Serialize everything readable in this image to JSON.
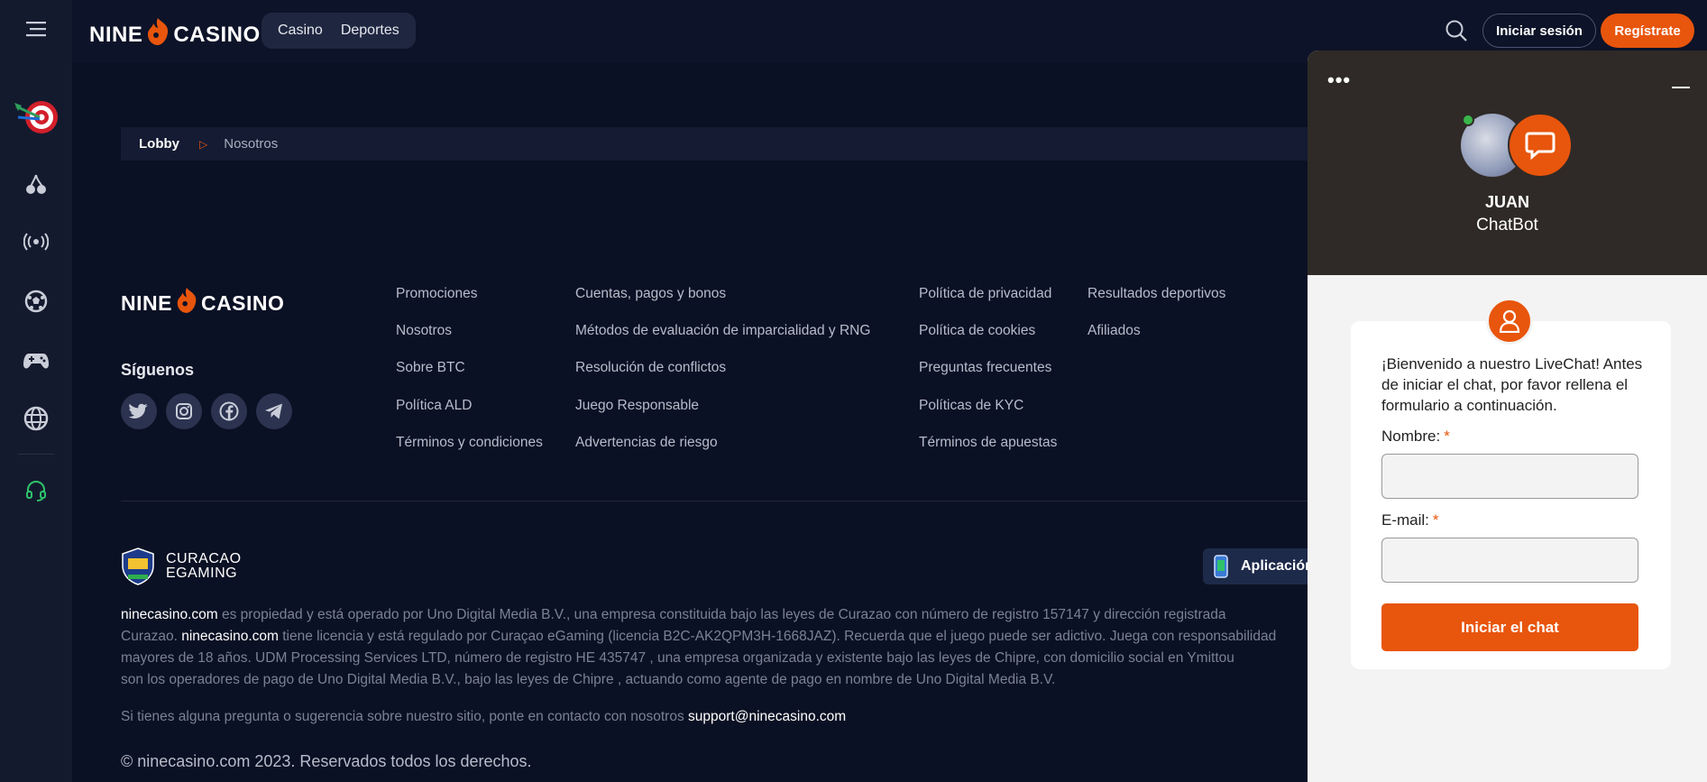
{
  "header": {
    "logo_left": "NINE",
    "logo_right": "CASINO",
    "nav": [
      "Casino",
      "Deportes"
    ],
    "login_label": "Iniciar sesión",
    "register_label": "Regístrate"
  },
  "sidebar": {
    "icons": [
      "menu-icon",
      "darts-icon",
      "cherry-icon",
      "live-broadcast-icon",
      "football-icon",
      "gamepad-icon",
      "globe-icon",
      "headset-icon"
    ]
  },
  "breadcrumb": {
    "home": "Lobby",
    "current": "Nosotros"
  },
  "footer": {
    "follow_title": "Síguenos",
    "socials": [
      "twitter-icon",
      "instagram-icon",
      "facebook-icon",
      "telegram-icon"
    ],
    "col1": [
      "Promociones",
      "Nosotros",
      "Sobre BTC",
      "Política ALD",
      "Términos y condiciones"
    ],
    "col2": [
      "Cuentas, pagos y bonos",
      "Métodos de evaluación de imparcialidad y RNG",
      "Resolución de conflictos",
      "Juego Responsable",
      "Advertencias de riesgo"
    ],
    "col3": [
      "Política de privacidad",
      "Política de cookies",
      "Preguntas frecuentes",
      "Políticas de KYC",
      "Términos de apuestas"
    ],
    "col4": [
      "Resultados deportivos",
      "Afiliados"
    ],
    "curacao_line1": "CURACAO",
    "curacao_line2": "EGAMING",
    "app_label": "Aplicación",
    "legal": {
      "site": "ninecasino.com",
      "l1": " es propiedad y está operado por Uno Digital Media B.V., una empresa constituida bajo las leyes de Curazao con número de registro 157147 y dirección registrada",
      "l2a": "Curazao. ",
      "l2b": " tiene licencia y está regulado por Curaçao eGaming (licencia B2C-AK2QPM3H-1668JAZ). Recuerda que el juego puede ser adictivo. Juega con responsabilidad",
      "l3": "mayores de 18 años. UDM Processing Services LTD, número de registro HE 435747 , una empresa organizada y existente bajo las leyes de Chipre, con domicilio social en Ymittou",
      "l4": "son los operadores de pago de Uno Digital Media B.V., bajo las leyes de Chipre , actuando como agente de pago en nombre de Uno Digital Media B.V."
    },
    "contact_text": "Si tienes alguna pregunta o sugerencia sobre nuestro sitio, ponte en contacto con nosotros ",
    "contact_email": "support@ninecasino.com",
    "copyright": "© ninecasino.com 2023. Reservados todos los derechos."
  },
  "chat": {
    "menu": "•••",
    "agent_name": "JUAN",
    "agent_role": "ChatBot",
    "welcome": "¡Bienvenido a nuestro LiveChat! Antes de iniciar el chat, por favor rellena el formulario a continuación.",
    "name_label": "Nombre:",
    "email_label": "E-mail:",
    "required_mark": "*",
    "name_value": "",
    "email_value": "",
    "start_label": "Iniciar el chat"
  },
  "colors": {
    "background": "#0b1124",
    "accent": "#e8550c",
    "chat_header": "#2f2a27",
    "online": "#39b54a"
  }
}
